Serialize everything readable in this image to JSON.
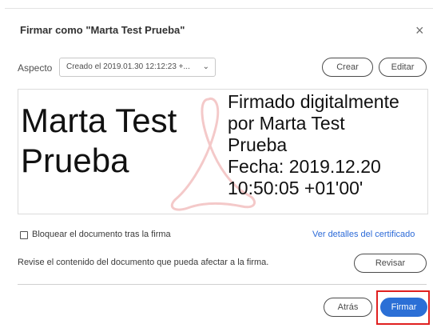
{
  "dialog": {
    "title": "Firmar como \"Marta Test Prueba\"",
    "close_icon": "×"
  },
  "aspect": {
    "label": "Aspecto",
    "selected": "Creado el 2019.01.30 12:12:23 +...",
    "chevron": "⌄"
  },
  "buttons": {
    "crear": "Crear",
    "editar": "Editar",
    "revisar": "Revisar",
    "atras": "Atrás",
    "firmar": "Firmar"
  },
  "preview": {
    "name_line1": "Marta Test",
    "name_line2": "Prueba",
    "details": [
      "Firmado digitalmente",
      "por Marta Test",
      "Prueba",
      "Fecha: 2019.12.20",
      "10:50:05 +01'00'"
    ],
    "watermark_icon": "acrobat-logo"
  },
  "options": {
    "lock_label": "Bloquear el documento tras la firma",
    "lock_checked": false,
    "cert_link": "Ver detalles del certificado"
  },
  "review": {
    "text": "Revise el contenido del documento que pueda afectar a la firma."
  },
  "colors": {
    "primary": "#2b6fd6",
    "link": "#2d6bd8",
    "highlight": "#e02020",
    "watermark": "#f4c9c9"
  }
}
